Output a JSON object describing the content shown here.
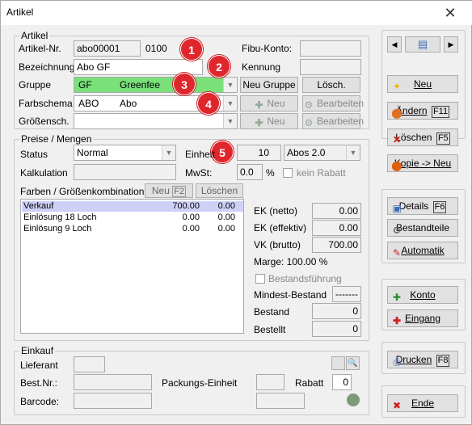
{
  "window": {
    "title": "Artikel",
    "close_glyph": "✕"
  },
  "artikel": {
    "legend": "Artikel",
    "artikel_nr_label": "Artikel-Nr.",
    "artikel_nr_value": "abo00001",
    "artikel_nr_suffix": "0100",
    "fibu_konto_label": "Fibu-Konto:",
    "fibu_konto_value": "",
    "bezeichnung_label": "Bezeichnung",
    "bezeichnung_value": "Abo GF",
    "kennung_label": "Kennung",
    "kennung_value": "",
    "gruppe_label": "Gruppe",
    "gruppe_code": "GF",
    "gruppe_name": "Greenfee",
    "neu_gruppe_button": "Neu Gruppe",
    "loesch_button": "Lösch.",
    "farbschema_label": "Farbschema",
    "farbschema_code": "ABO",
    "farbschema_name": "Abo",
    "neu_button": "Neu",
    "bearbeiten_button": "Bearbeiten",
    "groessensch_label": "Größensch.",
    "groessensch_value": ""
  },
  "badges": {
    "b1": "1",
    "b2": "2",
    "b3": "3",
    "b4": "4",
    "b5": "5"
  },
  "preise": {
    "legend": "Preise / Mengen",
    "status_label": "Status",
    "status_value": "Normal",
    "einheit_label": "Einheit",
    "einheit_value": "10",
    "einheit_unit": "Abos 2.0",
    "kalkulation_label": "Kalkulation",
    "kalkulation_value": "",
    "mwst_label": "MwSt:",
    "mwst_value": "0.0",
    "mwst_unit": "%",
    "kein_rabatt_label": "kein Rabatt",
    "farben_label": "Farben / Größenkombination",
    "neu_f2_button": "Neu",
    "neu_f2_key": "F2",
    "loeschen_button": "Löschen",
    "rows": [
      {
        "name": "Verkauf",
        "v1": "700.00",
        "v2": "0.00"
      },
      {
        "name": "Einlösung 18 Loch",
        "v1": "0.00",
        "v2": "0.00"
      },
      {
        "name": "Einlösung 9 Loch",
        "v1": "0.00",
        "v2": "0.00"
      }
    ],
    "ek_netto_label": "EK (netto)",
    "ek_netto_value": "0.00",
    "ek_effektiv_label": "EK (effektiv)",
    "ek_effektiv_value": "0.00",
    "vk_brutto_label": "VK (brutto)",
    "vk_brutto_value": "700.00",
    "marge_label": "Marge: 100.00 %",
    "bestandsfuehrung_label": "Bestandsführung",
    "mindest_bestand_label": "Mindest-Bestand",
    "mindest_bestand_value": "-------",
    "bestand_label": "Bestand",
    "bestand_value": "0",
    "bestellt_label": "Bestellt",
    "bestellt_value": "0"
  },
  "einkauf": {
    "legend": "Einkauf",
    "lieferant_label": "Lieferant",
    "lieferant_value": "",
    "best_nr_label": "Best.Nr.:",
    "best_nr_value": "",
    "packungs_einheit_label": "Packungs-Einheit",
    "packungs_einheit_value": "",
    "rabatt_label": "Rabatt",
    "rabatt_value": "0",
    "barcode_label": "Barcode:",
    "barcode_value": ""
  },
  "sidebar": {
    "neu": "Neu",
    "aendern": "Ändern",
    "aendern_key": "F11",
    "loeschen": "Löschen",
    "loeschen_key": "F5",
    "kopie_neu": "Kopie -> Neu",
    "details": "Details",
    "details_key": "F6",
    "bestandteile": "Bestandteile",
    "automatik": "Automatik",
    "konto": "Konto",
    "eingang": "Eingang",
    "drucken": "Drucken",
    "drucken_key": "F8",
    "ende": "Ende"
  },
  "colors": {
    "gruppe_highlight": "#79e07a",
    "selection": "#cfd0f8",
    "badge": "#e0262d"
  }
}
